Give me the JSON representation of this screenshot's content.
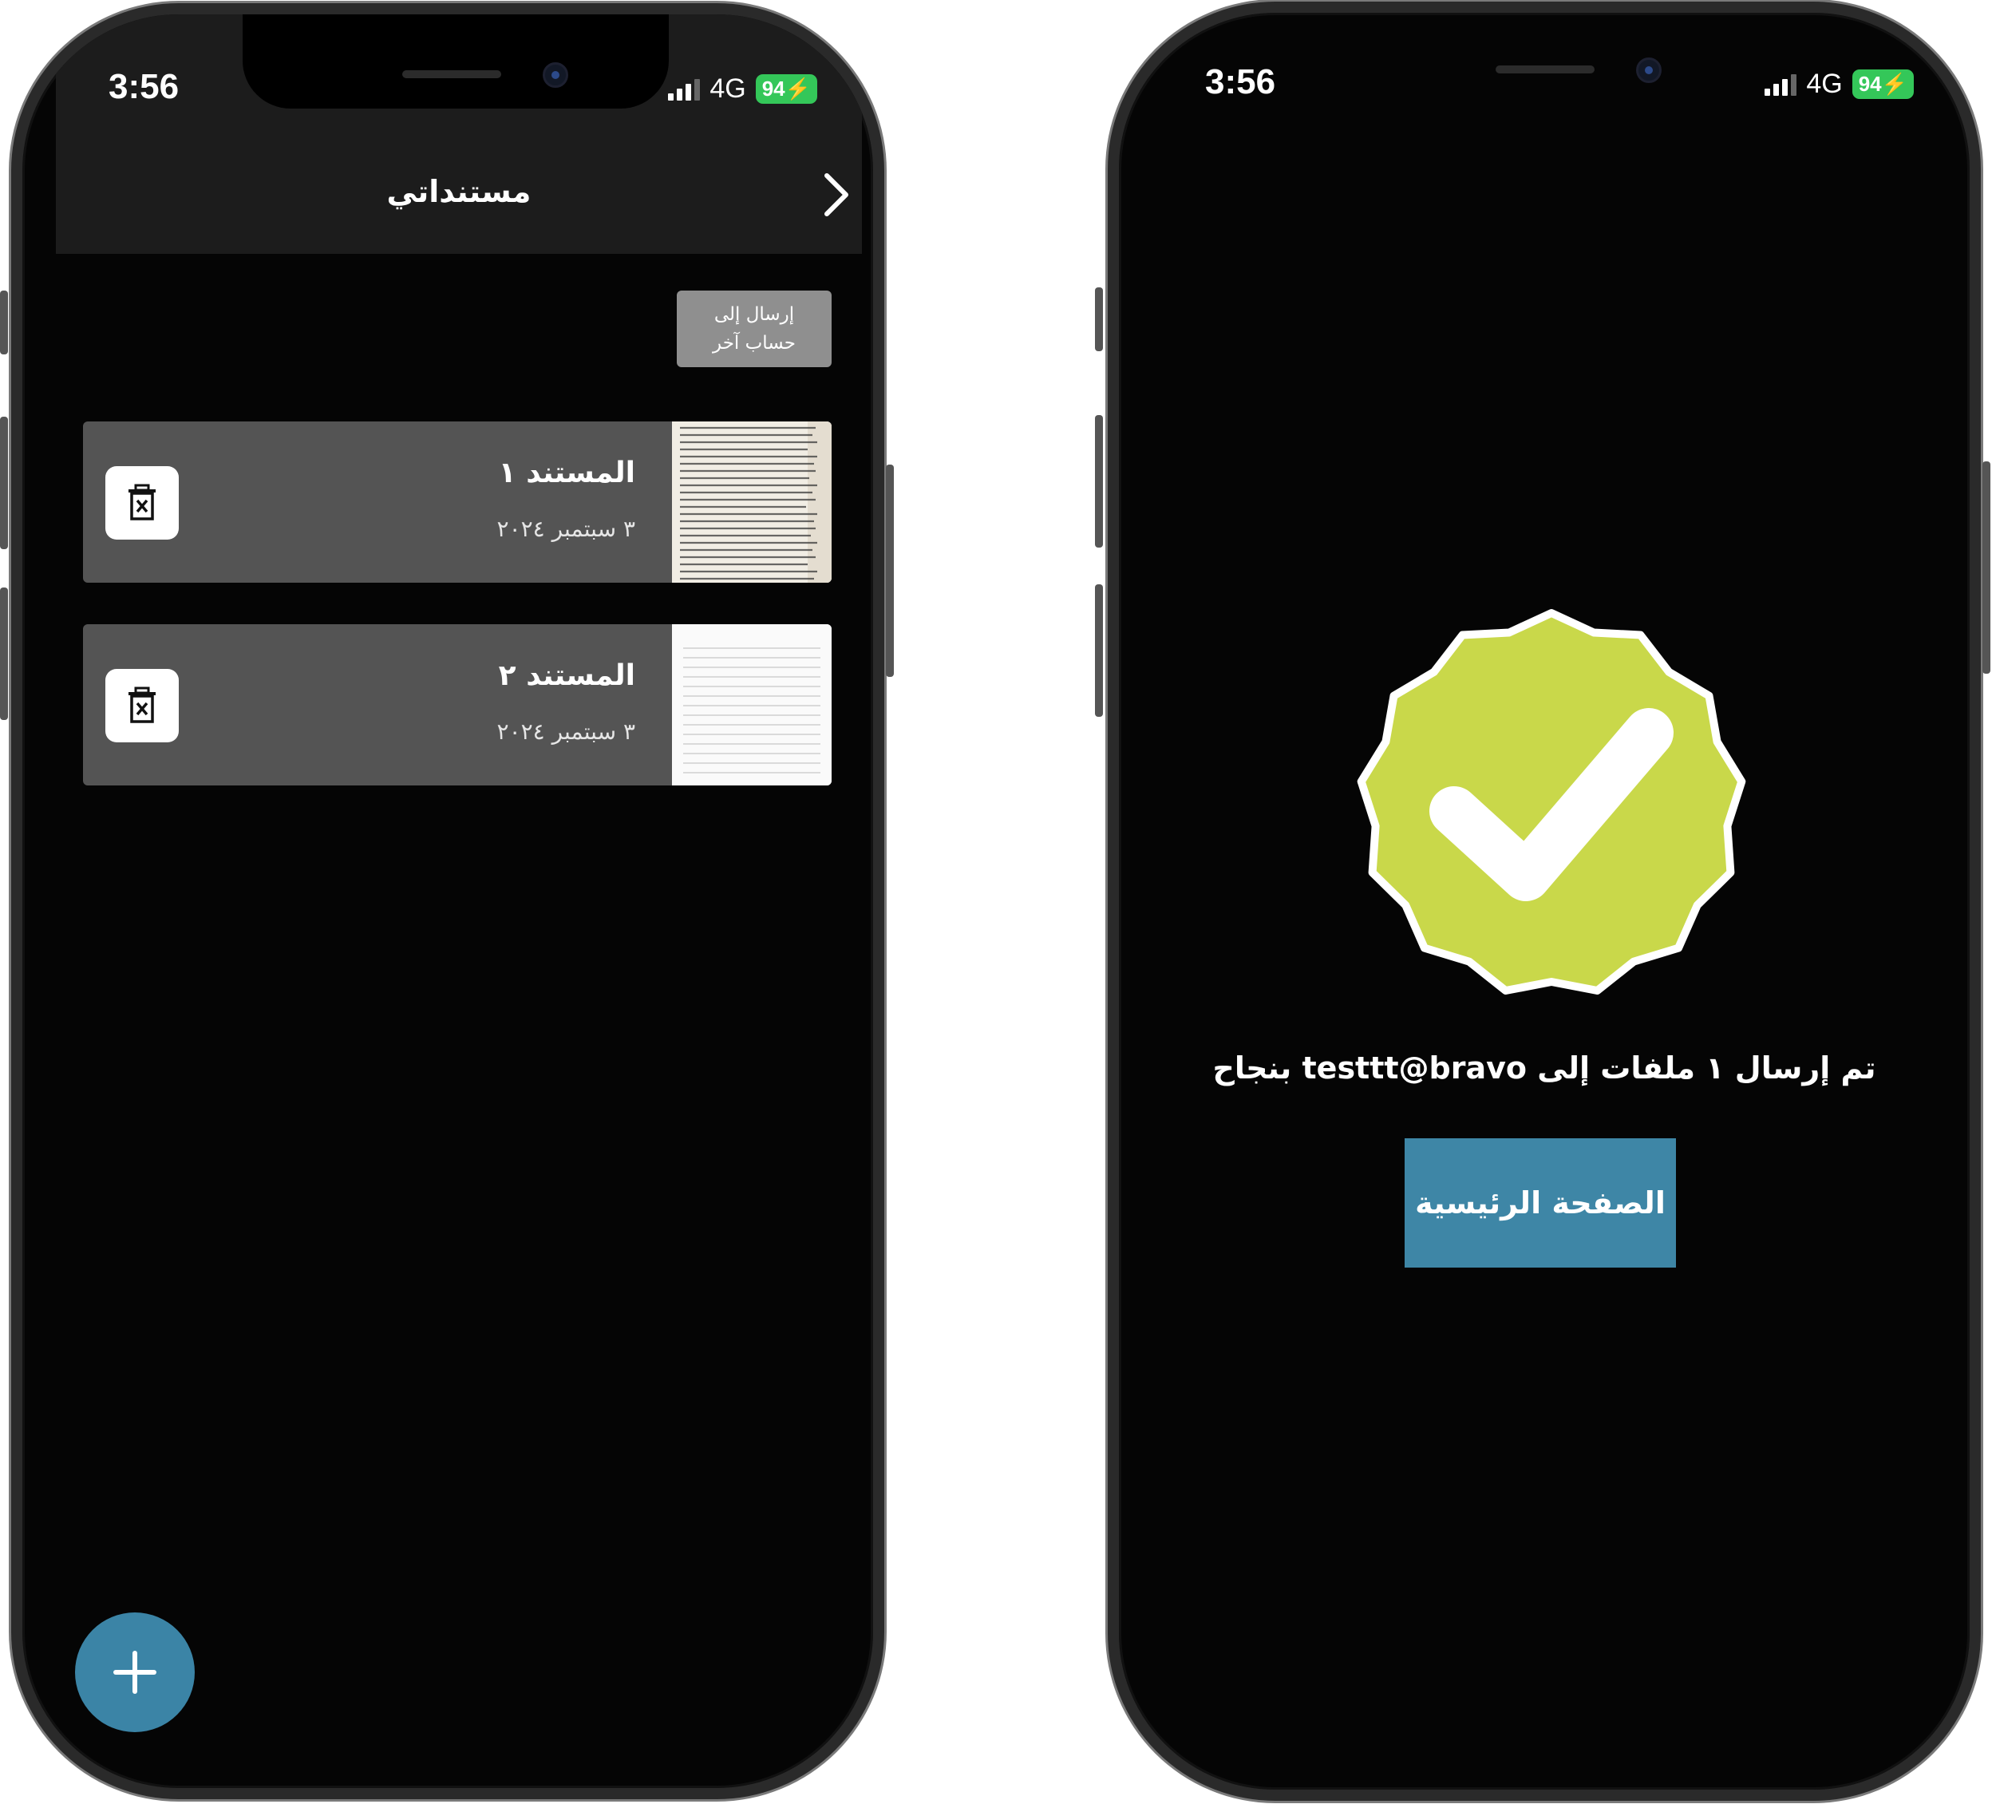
{
  "left_screen": {
    "status": {
      "time": "3:56",
      "network": "4G",
      "battery": "94"
    },
    "header": {
      "title": "مستنداتي",
      "back_icon": "chevron-right-icon"
    },
    "send_other_button": "إرسال إلى\nحساب آخر",
    "documents": [
      {
        "title": "المستند ١",
        "date": "٣ سبتمبر ٢٠٢٤",
        "thumbnail": "text-page-thumbnail"
      },
      {
        "title": "المستند ٢",
        "date": "٣ سبتمبر ٢٠٢٤",
        "thumbnail": "lined-page-thumbnail"
      }
    ],
    "fab_icon": "plus-icon"
  },
  "right_screen": {
    "status": {
      "time": "3:56",
      "network": "4G",
      "battery": "94"
    },
    "success_icon": "checkmark-badge-icon",
    "message": "تم إرسال ١ ملفات إلى testtt@bravo بنجاح",
    "home_button": "الصفحة الرئيسية"
  },
  "colors": {
    "background": "#000000",
    "header": "#1c1c1c",
    "card": "#545454",
    "send_button": "#8f8f8f",
    "accent_blue": "#3e86a6",
    "success_green": "#c9d84a",
    "battery_green": "#34c759"
  }
}
